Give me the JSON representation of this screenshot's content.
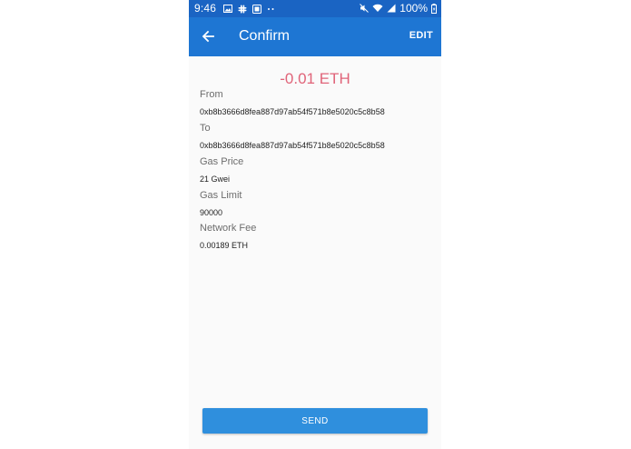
{
  "status_bar": {
    "time": "9:46",
    "battery_percent": "100%",
    "left_icons": [
      "image-icon",
      "slack-icon",
      "gallery-icon",
      "more-dots-icon"
    ],
    "right_icons": [
      "mute-icon",
      "wifi-icon",
      "signal-icon",
      "battery-charging-icon"
    ]
  },
  "app_bar": {
    "title": "Confirm",
    "edit_label": "EDIT",
    "back_icon": "arrow-back-icon"
  },
  "transaction": {
    "amount": "-0.01 ETH",
    "fields": [
      {
        "label": "From",
        "value": "0xb8b3666d8fea887d97ab54f571b8e5020c5c8b58"
      },
      {
        "label": "To",
        "value": "0xb8b3666d8fea887d97ab54f571b8e5020c5c8b58"
      },
      {
        "label": "Gas Price",
        "value": "21 Gwei"
      },
      {
        "label": "Gas Limit",
        "value": "90000"
      },
      {
        "label": "Network Fee",
        "value": "0.00189 ETH"
      }
    ]
  },
  "actions": {
    "send_label": "SEND"
  },
  "colors": {
    "status_bar": "#1a64c3",
    "app_bar": "#1e76d3",
    "amount_text": "#e06479",
    "send_button": "#2f8fdd",
    "background": "#fafafa"
  }
}
